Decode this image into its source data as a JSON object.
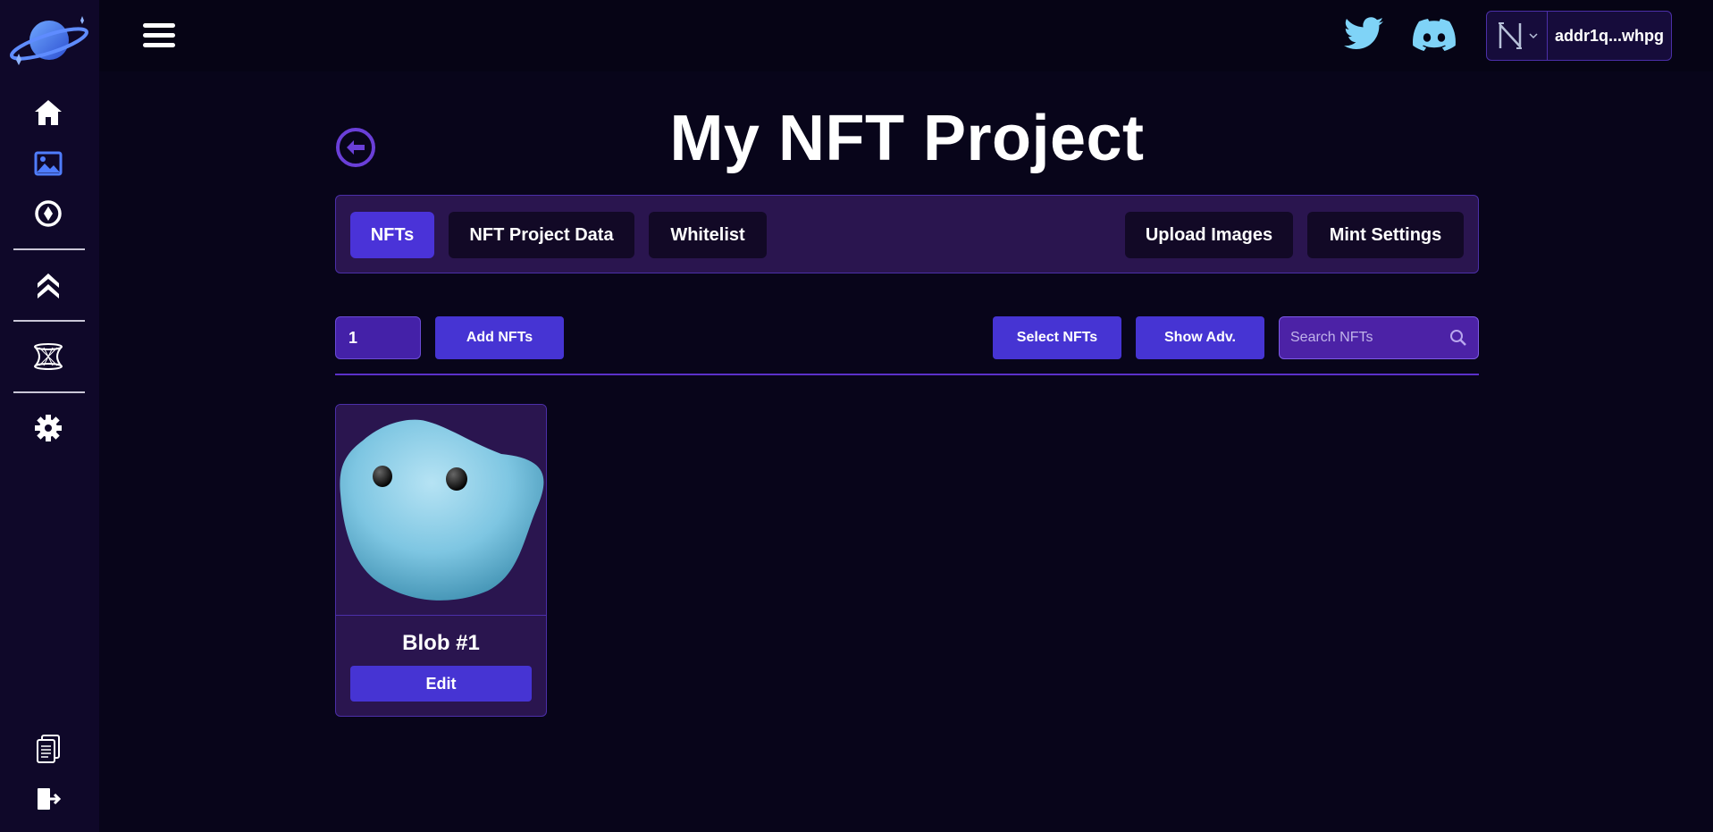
{
  "sidebar": {
    "logo": "planet-logo",
    "items": [
      {
        "icon": "home-icon"
      },
      {
        "icon": "image-icon"
      },
      {
        "icon": "compass-icon"
      },
      {
        "icon": "double-chevron-up-icon"
      },
      {
        "icon": "hyperboloid-icon"
      },
      {
        "icon": "gear-icon"
      },
      {
        "icon": "documents-icon"
      },
      {
        "icon": "logout-icon"
      }
    ]
  },
  "header": {
    "wallet_address": "addr1q...whpg",
    "social": [
      "twitter-icon",
      "discord-icon"
    ]
  },
  "page": {
    "title": "My NFT Project"
  },
  "tabs": {
    "nfts": "NFTs",
    "project_data": "NFT Project Data",
    "whitelist": "Whitelist",
    "upload_images": "Upload Images",
    "mint_settings": "Mint Settings"
  },
  "toolbar": {
    "quantity_value": "1",
    "add_label": "Add NFTs",
    "select_label": "Select NFTs",
    "show_adv_label": "Show Adv.",
    "search_placeholder": "Search NFTs"
  },
  "nfts": [
    {
      "name": "Blob #1",
      "edit_label": "Edit"
    }
  ],
  "colors": {
    "background": "#08051a",
    "sidebar": "#0f0829",
    "panel": "#2a154f",
    "accent": "#4634d3",
    "border": "#4b2fa8",
    "twitter": "#7fd3f7",
    "discord": "#7fd3f7"
  }
}
